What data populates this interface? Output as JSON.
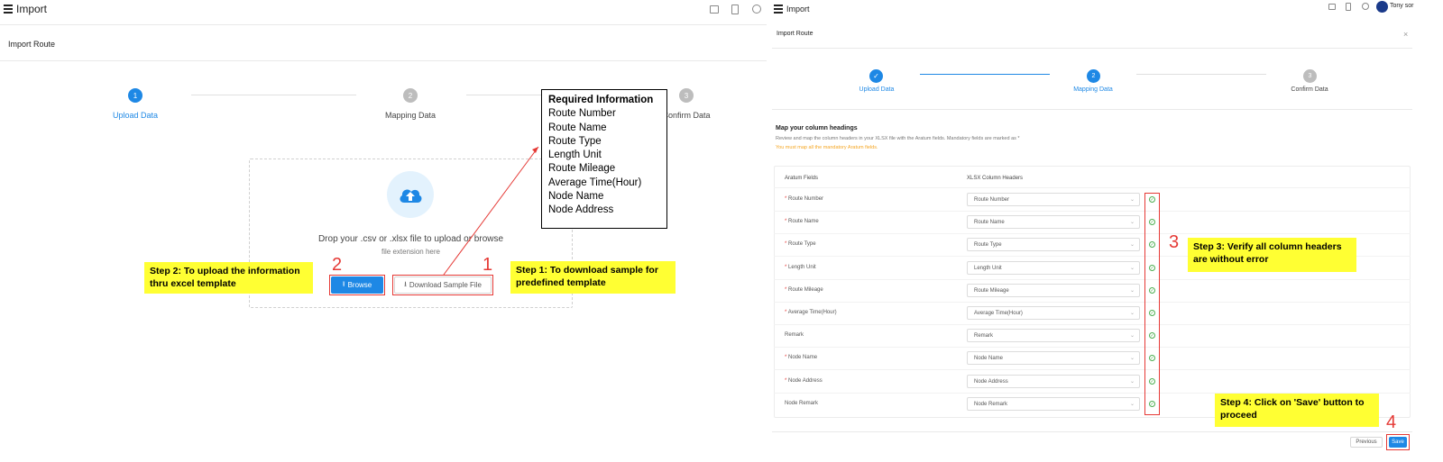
{
  "left": {
    "app_title": "Import",
    "page_title": "Import Route",
    "steps": [
      {
        "num": "1",
        "label": "Upload Data"
      },
      {
        "num": "2",
        "label": "Mapping Data"
      },
      {
        "num": "3",
        "label": "Confirm Data"
      }
    ],
    "drop_text": "Drop your .csv or .xlsx file to upload or browse",
    "drop_sub": "file extension here",
    "browse_label": "Browse",
    "download_label": "Download Sample File",
    "info_box": {
      "title": "Required Information",
      "items": [
        "Route Number",
        "Route Name",
        "Route Type",
        "Length Unit",
        "Route Mileage",
        "Average Time(Hour)",
        "Node Name",
        "Node Address"
      ]
    },
    "annotations": {
      "step1": "Step 1: To download sample for predefined template",
      "step2": "Step 2: To upload the information thru excel template",
      "num1": "1",
      "num2": "2"
    }
  },
  "right": {
    "app_title": "Import",
    "user_name": "Tony sor",
    "page_title": "Import Route",
    "close_glyph": "×",
    "steps": [
      {
        "num": "✓",
        "label": "Upload Data"
      },
      {
        "num": "2",
        "label": "Mapping Data"
      },
      {
        "num": "3",
        "label": "Confirm Data"
      }
    ],
    "map_title": "Map your column headings",
    "map_sub": "Review and map the column headers in your XLSX file with the Aratum fields. Mandatory fields are marked as *",
    "map_warn": "You must map all the mandatory Aratum fields.",
    "col1": "Aratum Fields",
    "col2": "XLSX Column Headers",
    "rows": [
      {
        "req": "*",
        "label": "Route Number",
        "value": "Route Number"
      },
      {
        "req": "*",
        "label": "Route Name",
        "value": "Route Name"
      },
      {
        "req": "*",
        "label": "Route Type",
        "value": "Route Type"
      },
      {
        "req": "*",
        "label": "Length Unit",
        "value": "Length Unit"
      },
      {
        "req": "*",
        "label": "Route Mileage",
        "value": "Route Mileage"
      },
      {
        "req": "*",
        "label": "Average Time(Hour)",
        "value": "Average Time(Hour)"
      },
      {
        "req": "",
        "label": "Remark",
        "value": "Remark"
      },
      {
        "req": "*",
        "label": "Node Name",
        "value": "Node Name"
      },
      {
        "req": "*",
        "label": "Node Address",
        "value": "Node Address"
      },
      {
        "req": "",
        "label": "Node Remark",
        "value": "Node Remark"
      }
    ],
    "previous_label": "Previous",
    "save_label": "Save",
    "annotations": {
      "step3": "Step 3: Verify all column headers are without error",
      "step4": "Step 4: Click on 'Save' button to proceed",
      "num3": "3",
      "num4": "4"
    }
  },
  "colors": {
    "accent": "#1e88e5",
    "annotation_red": "#e53935",
    "note_yellow": "#ffff33",
    "success": "#4caf50"
  }
}
